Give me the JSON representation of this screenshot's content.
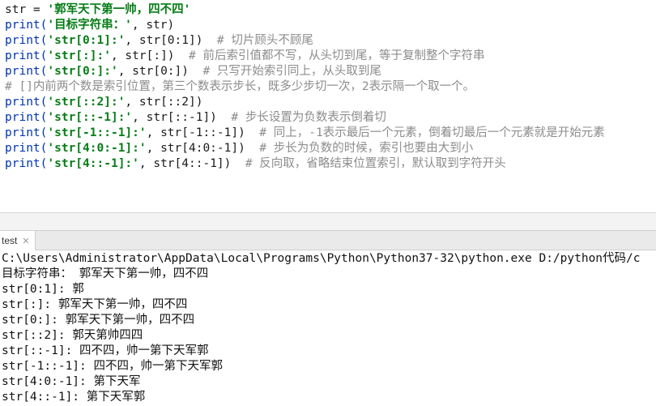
{
  "editor": {
    "lines": [
      [
        {
          "t": "plain",
          "v": "str = "
        },
        {
          "t": "str",
          "v": "'郭军天下第一帅，四不四'"
        }
      ],
      [
        {
          "t": "kw",
          "v": "print("
        },
        {
          "t": "str",
          "v": "'目标字符串：'"
        },
        {
          "t": "plain",
          "v": ", str)"
        }
      ],
      [
        {
          "t": "kw",
          "v": "print("
        },
        {
          "t": "str",
          "v": "'str[0:1]:'"
        },
        {
          "t": "plain",
          "v": ", str[0:1])  "
        },
        {
          "t": "cmt",
          "v": "# 切片顾头不顾尾"
        }
      ],
      [
        {
          "t": "kw",
          "v": "print("
        },
        {
          "t": "str",
          "v": "'str[:]:'"
        },
        {
          "t": "plain",
          "v": ", str[:])  "
        },
        {
          "t": "cmt",
          "v": "# 前后索引值都不写，从头切到尾，等于复制整个字符串"
        }
      ],
      [
        {
          "t": "kw",
          "v": "print("
        },
        {
          "t": "str",
          "v": "'str[0:]:'"
        },
        {
          "t": "plain",
          "v": ", str[0:])  "
        },
        {
          "t": "cmt",
          "v": "# 只写开始索引同上，从头取到尾"
        }
      ],
      [
        {
          "t": "cmt",
          "v": "# []内前两个数是索引位置，第三个数表示步长，既多少步切一次，2表示隔一个取一个。"
        }
      ],
      [
        {
          "t": "kw",
          "v": "print("
        },
        {
          "t": "str",
          "v": "'str[::2]:'"
        },
        {
          "t": "plain",
          "v": ", str[::2])"
        }
      ],
      [
        {
          "t": "kw",
          "v": "print("
        },
        {
          "t": "str",
          "v": "'str[::-1]:'"
        },
        {
          "t": "plain",
          "v": ", str[::-1])  "
        },
        {
          "t": "cmt",
          "v": "# 步长设置为负数表示倒着切"
        }
      ],
      [
        {
          "t": "kw",
          "v": "print("
        },
        {
          "t": "str",
          "v": "'str[-1::-1]:'"
        },
        {
          "t": "plain",
          "v": ", str[-1::-1])  "
        },
        {
          "t": "cmt",
          "v": "# 同上，-1表示最后一个元素，倒着切最后一个元素就是开始元素"
        }
      ],
      [
        {
          "t": "kw",
          "v": "print("
        },
        {
          "t": "str",
          "v": "'str[4:0:-1]:'"
        },
        {
          "t": "plain",
          "v": ", str[4:0:-1])  "
        },
        {
          "t": "cmt",
          "v": "# 步长为负数的时候，索引也要由大到小"
        }
      ],
      [
        {
          "t": "kw",
          "v": "print("
        },
        {
          "t": "str",
          "v": "'str[4::-1]:'"
        },
        {
          "t": "plain",
          "v": ", str[4::-1])  "
        },
        {
          "t": "cmt",
          "v": "# 反向取，省略结束位置索引，默认取到字符开头"
        }
      ]
    ]
  },
  "run_panel": {
    "tab_label": "test",
    "close_glyph": "✕"
  },
  "console": {
    "lines": [
      "C:\\Users\\Administrator\\AppData\\Local\\Programs\\Python\\Python37-32\\python.exe D:/python代码/c",
      "目标字符串： 郭军天下第一帅，四不四",
      "str[0:1]: 郭",
      "str[:]: 郭军天下第一帅，四不四",
      "str[0:]: 郭军天下第一帅，四不四",
      "str[::2]: 郭天第帅四四",
      "str[::-1]: 四不四，帅一第下天军郭",
      "str[-1::-1]: 四不四，帅一第下天军郭",
      "str[4:0:-1]: 第下天军",
      "str[4::-1]: 第下天军郭"
    ]
  }
}
